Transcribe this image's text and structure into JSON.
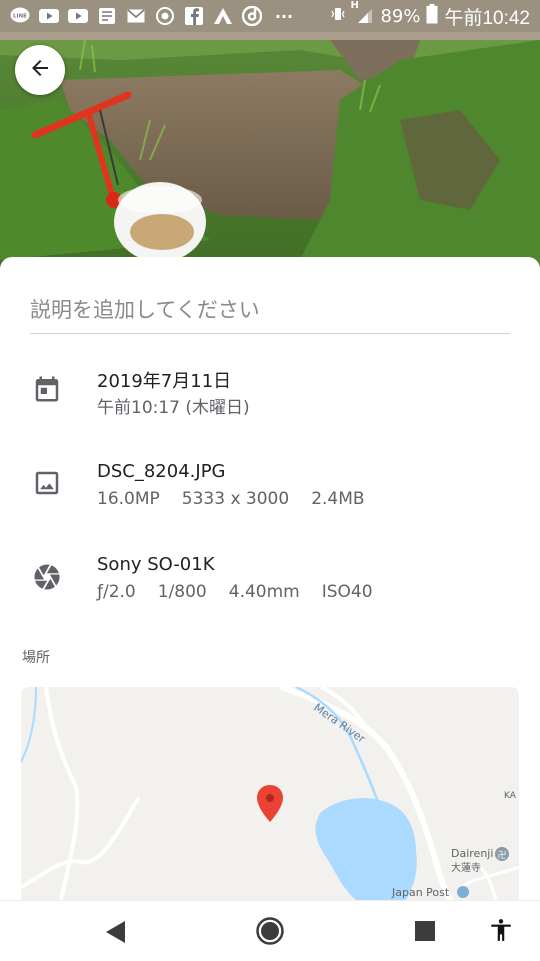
{
  "status_bar": {
    "battery": "89%",
    "time": "午前10:42",
    "signal_label": "H",
    "more": "···",
    "line_label": "LINE"
  },
  "description": {
    "placeholder": "説明を追加してください"
  },
  "details": {
    "date": {
      "line1": "2019年7月11日",
      "line2": "午前10:17 (木曜日)"
    },
    "file": {
      "name": "DSC_8204.JPG",
      "specs": [
        "16.0MP",
        "5333 x 3000",
        "2.4MB"
      ]
    },
    "camera": {
      "model": "Sony SO-01K",
      "specs": [
        "ƒ/2.0",
        "1/800",
        "4.40mm",
        "ISO40"
      ]
    }
  },
  "location": {
    "label": "場所",
    "map_labels": {
      "river": "Mera River",
      "temple_en": "Dairenji",
      "temple_jp": "大蓮寺",
      "post": "Japan Post",
      "edge": "KA"
    }
  },
  "colors": {
    "pin": "#ea4335",
    "water": "#aadaff",
    "map_bg": "#f2f1ee"
  }
}
